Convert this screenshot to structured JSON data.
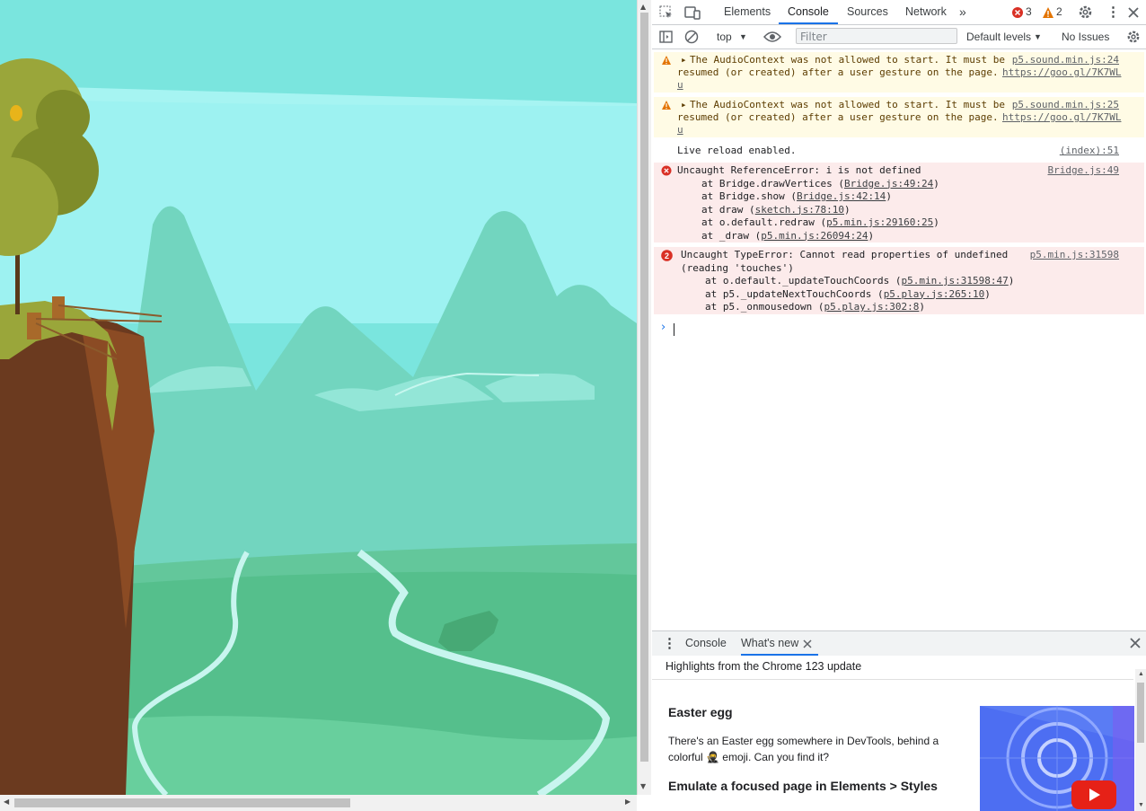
{
  "devtools": {
    "tabs": [
      "Elements",
      "Console",
      "Sources",
      "Network"
    ],
    "active_tab": "Console",
    "error_count": "3",
    "warning_count": "2",
    "toolbar": {
      "context": "top",
      "filter_placeholder": "Filter",
      "levels": "Default levels",
      "issues": "No Issues"
    },
    "messages": [
      {
        "level": "warning",
        "line1": "The AudioContext was not allowed to start. It must be",
        "line2": "resumed (or created) after a user gesture on the page.",
        "link_a": "https://goo.gl/7K7WL",
        "link_b": "u",
        "source": "p5.sound.min.js:24"
      },
      {
        "level": "warning",
        "line1": "The AudioContext was not allowed to start. It must be",
        "line2": "resumed (or created) after a user gesture on the page.",
        "link_a": "https://goo.gl/7K7WL",
        "link_b": "u",
        "source": "p5.sound.min.js:25"
      },
      {
        "level": "info",
        "line1": "Live reload enabled.",
        "source": "(index):51"
      },
      {
        "level": "error",
        "line1": "Uncaught ReferenceError: i is not defined",
        "source": "Bridge.js:49",
        "stack": [
          {
            "pre": "at Bridge.drawVertices (",
            "link": "Bridge.js:49:24",
            "post": ")"
          },
          {
            "pre": "at Bridge.show (",
            "link": "Bridge.js:42:14",
            "post": ")"
          },
          {
            "pre": "at draw (",
            "link": "sketch.js:78:10",
            "post": ")"
          },
          {
            "pre": "at o.default.redraw (",
            "link": "p5.min.js:29160:25",
            "post": ")"
          },
          {
            "pre": "at _draw (",
            "link": "p5.min.js:26094:24",
            "post": ")"
          }
        ]
      },
      {
        "level": "error",
        "count": "2",
        "line1": "Uncaught TypeError: Cannot read properties of undefined",
        "line2": "(reading 'touches')",
        "source": "p5.min.js:31598",
        "stack": [
          {
            "pre": "at o.default._updateTouchCoords (",
            "link": "p5.min.js:31598:47",
            "post": ")"
          },
          {
            "pre": "at p5._updateNextTouchCoords (",
            "link": "p5.play.js:265:10",
            "post": ")"
          },
          {
            "pre": "at p5._onmousedown (",
            "link": "p5.play.js:302:8",
            "post": ")"
          }
        ]
      }
    ],
    "prompt": "›",
    "drawer": {
      "tabs": [
        "Console",
        "What's new"
      ],
      "active_tab": "What's new",
      "heading": "Highlights from the Chrome 123 update",
      "items": [
        {
          "title": "Easter egg",
          "body": "There's an Easter egg somewhere in DevTools, behind a colorful 🥷 emoji. Can you find it?"
        },
        {
          "title": "Emulate a focused page in Elements > Styles",
          "body": ""
        }
      ]
    },
    "colors": {
      "accent": "#1a73e8",
      "error": "#d93025",
      "warning": "#e37400"
    }
  }
}
